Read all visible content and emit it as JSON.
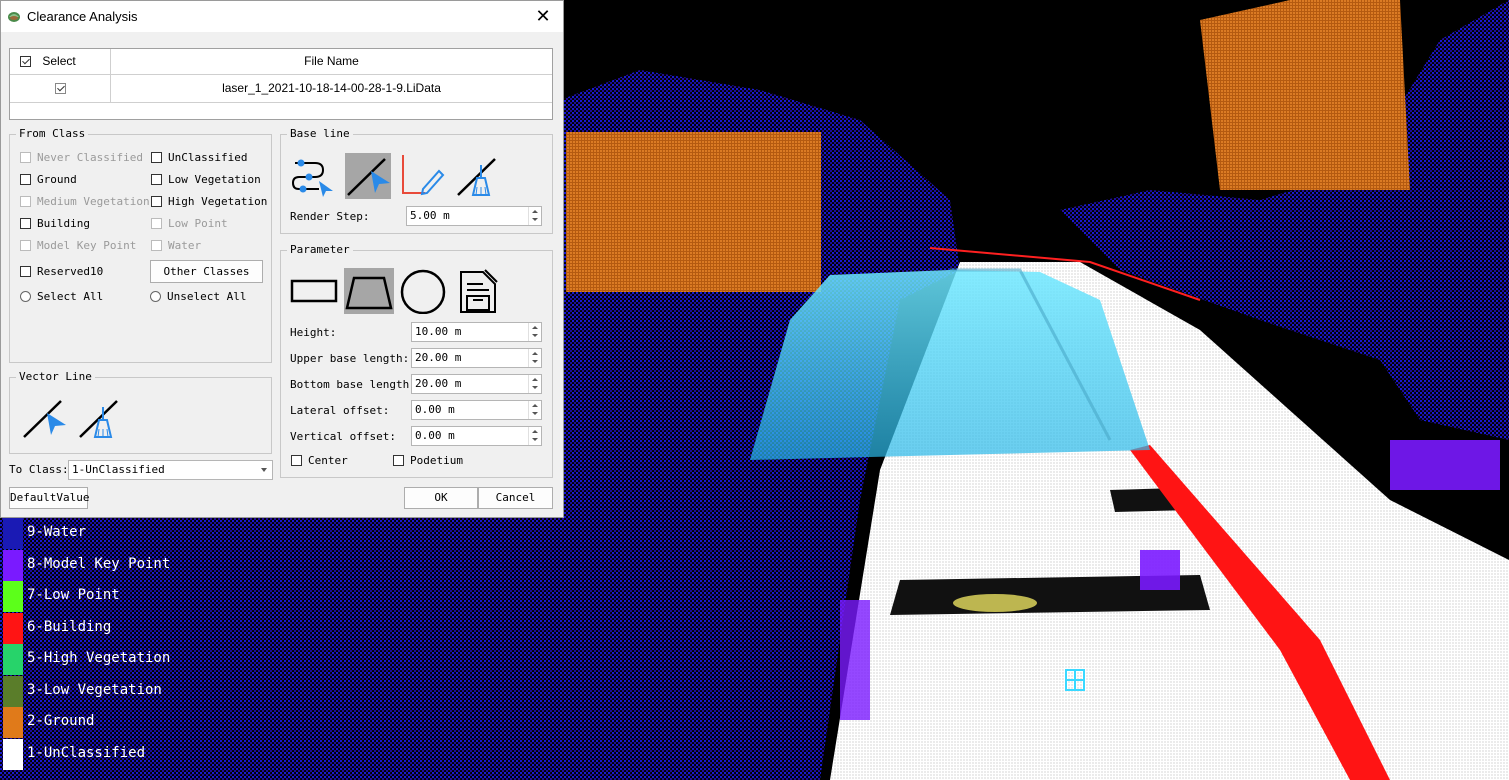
{
  "dialog": {
    "title": "Clearance Analysis",
    "close_glyph": "✕",
    "table": {
      "headers": [
        "Select",
        "File Name"
      ],
      "rows": [
        {
          "checked": true,
          "file": "laser_1_2021-10-18-14-00-28-1-9.LiData"
        }
      ]
    },
    "from_class": {
      "title": "From Class",
      "classes": [
        {
          "label": "Never Classified",
          "enabled": false
        },
        {
          "label": "UnClassified",
          "enabled": true
        },
        {
          "label": "Ground",
          "enabled": true
        },
        {
          "label": "Low Vegetation",
          "enabled": true
        },
        {
          "label": "Medium Vegetation",
          "enabled": false
        },
        {
          "label": "High Vegetation",
          "enabled": true
        },
        {
          "label": "Building",
          "enabled": true
        },
        {
          "label": "Low Point",
          "enabled": false
        },
        {
          "label": "Model Key Point",
          "enabled": false
        },
        {
          "label": "Water",
          "enabled": false
        },
        {
          "label": "Reserved10",
          "enabled": true
        }
      ],
      "other_classes_button": "Other Classes",
      "select_all": "Select All",
      "unselect_all": "Unselect All"
    },
    "vector_line": {
      "title": "Vector Line",
      "icons": [
        "draw-line-icon",
        "clear-line-icon"
      ]
    },
    "to_class": {
      "label": "To Class:",
      "value": "1-UnClassified"
    },
    "base_line": {
      "title": "Base line",
      "icons": [
        "route-select-icon",
        "draw-line-icon",
        "edit-line-icon",
        "clear-line-icon"
      ],
      "render_step_label": "Render Step:",
      "render_step_value": "5.00 m"
    },
    "parameter": {
      "title": "Parameter",
      "icons": [
        "rectangle-shape-icon",
        "trapezoid-shape-icon",
        "circle-shape-icon",
        "save-template-icon"
      ],
      "fields": [
        {
          "label": "Height:",
          "value": "10.00 m"
        },
        {
          "label": "Upper base length:",
          "value": "20.00 m"
        },
        {
          "label": "Bottom base length:",
          "value": "20.00 m"
        },
        {
          "label": "Lateral offset:",
          "value": "0.00 m"
        },
        {
          "label": "Vertical offset:",
          "value": "0.00 m"
        }
      ],
      "center_label": "Center",
      "podetium_label": "Podetium"
    },
    "default_button": "DefaultValue",
    "ok_button": "OK",
    "cancel_button": "Cancel"
  },
  "legend": [
    {
      "label": "9-Water",
      "color": "#1a1ab4"
    },
    {
      "label": "8-Model Key Point",
      "color": "#7a1aff"
    },
    {
      "label": "7-Low Point",
      "color": "#5cff1a"
    },
    {
      "label": "6-Building",
      "color": "#ff1414"
    },
    {
      "label": "5-High Vegetation",
      "color": "#27d36a"
    },
    {
      "label": "3-Low Vegetation",
      "color": "#5a7d2a"
    },
    {
      "label": "2-Ground",
      "color": "#e07a1a"
    },
    {
      "label": "1-UnClassified",
      "color": "#ffffff"
    }
  ]
}
